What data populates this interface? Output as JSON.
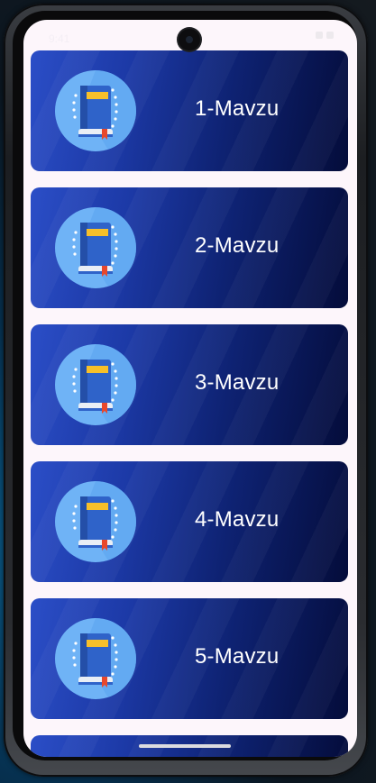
{
  "status_bar": {
    "time": "9:41"
  },
  "topics": [
    {
      "label": "1-Mavzu",
      "icon": "book-icon"
    },
    {
      "label": "2-Mavzu",
      "icon": "book-icon"
    },
    {
      "label": "3-Mavzu",
      "icon": "book-icon"
    },
    {
      "label": "4-Mavzu",
      "icon": "book-icon"
    },
    {
      "label": "5-Mavzu",
      "icon": "book-icon"
    }
  ],
  "colors": {
    "card_gradient_start": "#2b4ec7",
    "card_gradient_end": "#040c3a",
    "icon_circle": "#6fb3f6",
    "screen_background": "#fdf6fb"
  }
}
